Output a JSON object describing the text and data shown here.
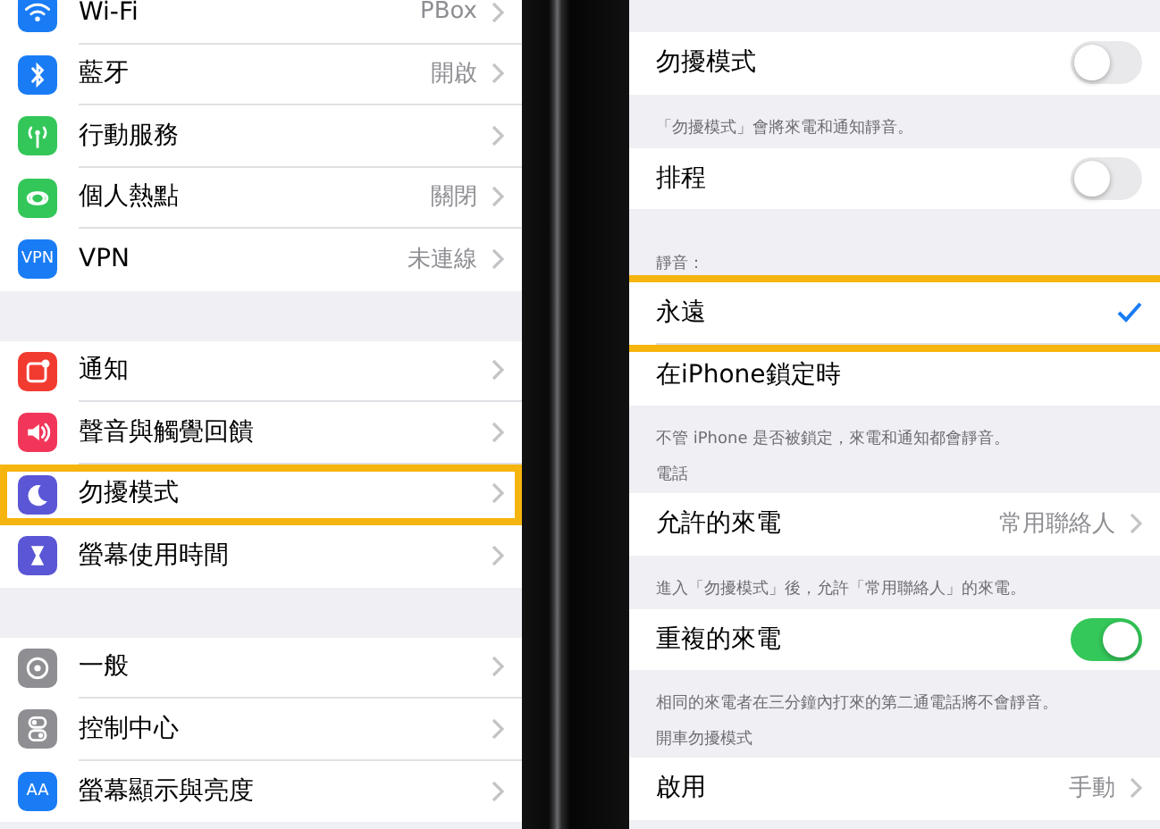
{
  "settings_list": {
    "groups": [
      [
        {
          "label": "Wi-Fi",
          "value": "PBox",
          "color": "#1a7cf5",
          "highlighted": false
        },
        {
          "label": "藍牙",
          "value": "開啟",
          "color": "#1a7cf5",
          "highlighted": false
        },
        {
          "label": "行動服務",
          "color": "#33c759",
          "highlighted": false
        },
        {
          "label": "個人熱點",
          "value": "關閉",
          "color": "#33c759",
          "highlighted": false
        },
        {
          "label": "VPN",
          "value": "未連線",
          "color": "#1a7cf5",
          "badge": "VPN",
          "highlighted": false
        }
      ],
      [
        {
          "label": "通知",
          "color": "#f23b30",
          "highlighted": false
        },
        {
          "label": "聲音與觸覺回饋",
          "color": "#f2365a",
          "highlighted": false
        },
        {
          "label": "勿擾模式",
          "color": "#5a56d6",
          "highlighted": true
        },
        {
          "label": "螢幕使用時間",
          "color": "#5a56d6",
          "highlighted": false
        }
      ],
      [
        {
          "label": "一般",
          "color": "#8e8e93",
          "highlighted": false
        },
        {
          "label": "控制中心",
          "color": "#8e8e93",
          "highlighted": false
        },
        {
          "label": "螢幕顯示與亮度",
          "color": "#1a7cf5",
          "badge": "AA",
          "highlighted": false
        }
      ]
    ]
  },
  "do_not_disturb": {
    "sections": [
      {
        "rows": [
          {
            "kind": "toggle",
            "label": "勿擾模式",
            "on": false,
            "highlighted": false
          }
        ],
        "footer": "「勿擾模式」會將來電和通知靜音。"
      },
      {
        "rows": [
          {
            "kind": "toggle",
            "label": "排程",
            "on": false,
            "highlighted": false
          }
        ]
      },
      {
        "header": "靜音：",
        "rows": [
          {
            "kind": "option",
            "label": "永遠",
            "checked": true,
            "highlighted": true
          },
          {
            "kind": "option",
            "label": "在iPhone鎖定時",
            "checked": false,
            "highlighted": false
          }
        ],
        "footer": "不管 iPhone 是否被鎖定，來電和通知都會靜音。"
      },
      {
        "header": "電話",
        "rows": [
          {
            "kind": "link",
            "label": "允許的來電",
            "value": "常用聯絡人",
            "highlighted": false
          }
        ],
        "footer": "進入「勿擾模式」後，允許「常用聯絡人」的來電。"
      },
      {
        "rows": [
          {
            "kind": "toggle",
            "label": "重複的來電",
            "on": true,
            "highlighted": false
          }
        ],
        "footer": "相同的來電者在三分鐘內打來的第二通電話將不會靜音。"
      },
      {
        "header": "開車勿擾模式",
        "rows": [
          {
            "kind": "link",
            "label": "啟用",
            "value": "手動",
            "highlighted": false
          }
        ]
      }
    ]
  }
}
